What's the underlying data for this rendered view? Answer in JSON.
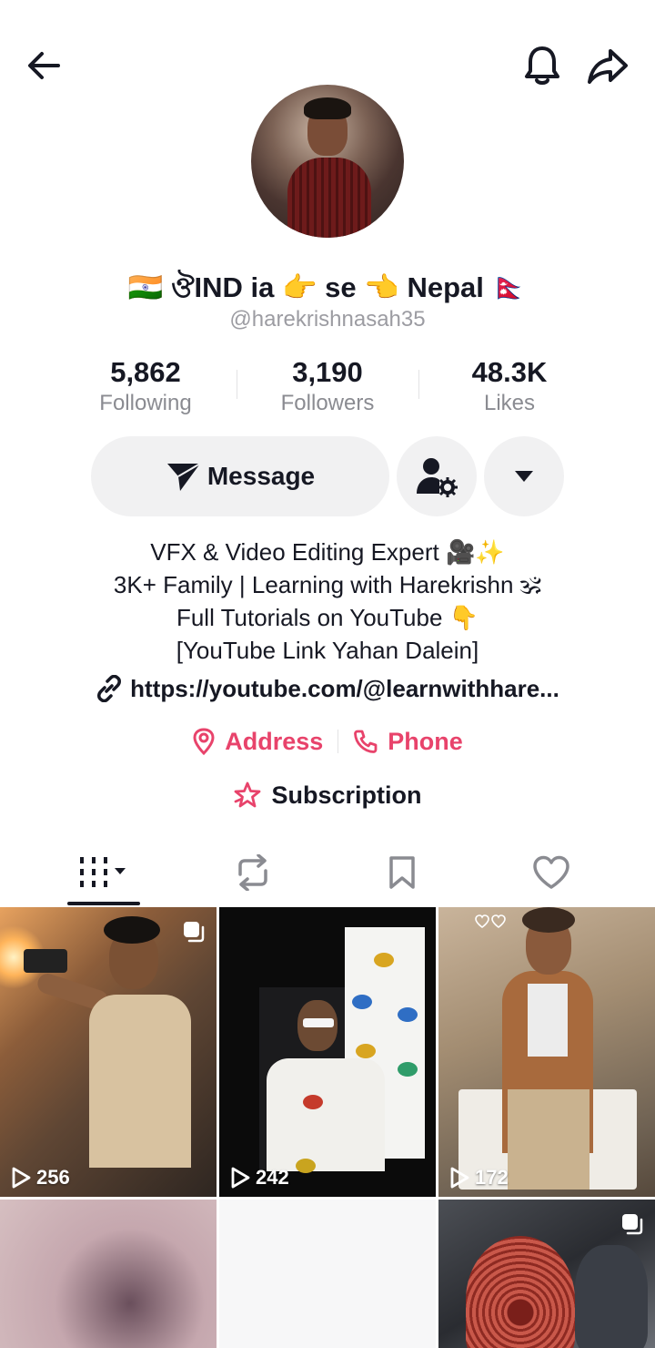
{
  "header": {
    "back_icon": "arrow-left-icon",
    "bell_icon": "bell-icon",
    "share_icon": "share-icon"
  },
  "profile": {
    "display_name": "🇮🇳 ঔIND ia 👉 se 👈 Nepal 🇳🇵",
    "username": "@harekrishnasah35"
  },
  "stats": [
    {
      "value": "5,862",
      "label": "Following"
    },
    {
      "value": "3,190",
      "label": "Followers"
    },
    {
      "value": "48.3K",
      "label": "Likes"
    }
  ],
  "actions": {
    "message_label": "Message",
    "message_icon": "send-icon",
    "user_settings_icon": "user-gear-icon",
    "more_icon": "caret-down-icon"
  },
  "bio": [
    "VFX & Video Editing Expert 🎥✨",
    "3K+ Family | Learning with Harekrishn 🕉",
    "Full Tutorials on YouTube 👇",
    "[YouTube Link Yahan Dalein]"
  ],
  "link": {
    "text": "https://youtube.com/@learnwithhare...",
    "icon": "link-icon"
  },
  "contacts": {
    "address_label": "Address",
    "phone_label": "Phone"
  },
  "subscription": {
    "label": "Subscription",
    "icon": "star-badge-icon"
  },
  "tabs": [
    {
      "name": "videos",
      "icon": "grid-icon",
      "active": true
    },
    {
      "name": "reposts",
      "icon": "repost-icon"
    },
    {
      "name": "saved",
      "icon": "bookmark-icon"
    },
    {
      "name": "liked",
      "icon": "heart-icon"
    }
  ],
  "videos": [
    {
      "views": "256"
    },
    {
      "views": "242"
    },
    {
      "views": "172"
    }
  ],
  "colors": {
    "accent": "#e8436b",
    "text": "#161823",
    "muted": "#8a8b91",
    "button_bg": "#f1f1f2"
  }
}
